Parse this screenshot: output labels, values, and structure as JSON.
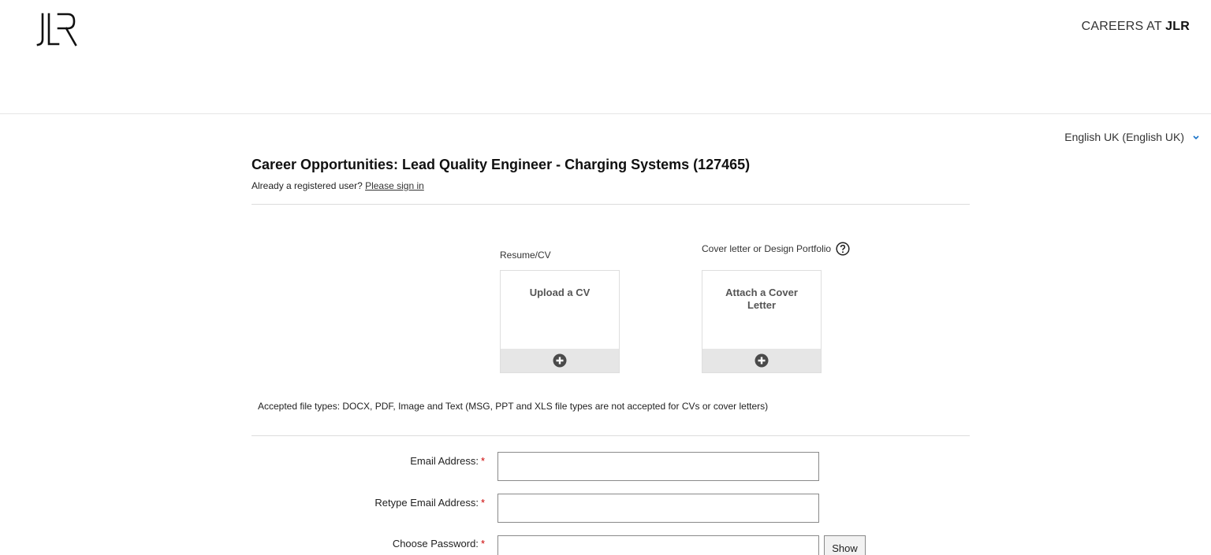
{
  "header": {
    "logo_text": "JLR",
    "careers_prefix": "CAREERS AT ",
    "careers_brand": "JLR"
  },
  "language": {
    "selected": "English UK (English UK)"
  },
  "job": {
    "title": "Career Opportunities: Lead Quality Engineer - Charging Systems (127465)",
    "signin_prompt": "Already a registered user? ",
    "signin_link": "Please sign in"
  },
  "uploads": {
    "cv_label": "Resume/CV",
    "cv_button": "Upload a CV",
    "cover_label": "Cover letter or Design Portfolio",
    "cover_button": "Attach a Cover Letter",
    "accepted_types": "Accepted file types: DOCX, PDF, Image and Text (MSG, PPT and XLS file types are not accepted for CVs or cover letters)"
  },
  "form": {
    "email_label": "Email Address:",
    "email_value": "",
    "retype_email_label": "Retype Email Address:",
    "retype_email_value": "",
    "password_label": "Choose Password:",
    "password_value": "",
    "required_marker": "*",
    "show_button": "Show"
  },
  "colors": {
    "required": "#cc0000",
    "link_chevron": "#1a73c9",
    "tile_footer": "#e6e6e6"
  }
}
